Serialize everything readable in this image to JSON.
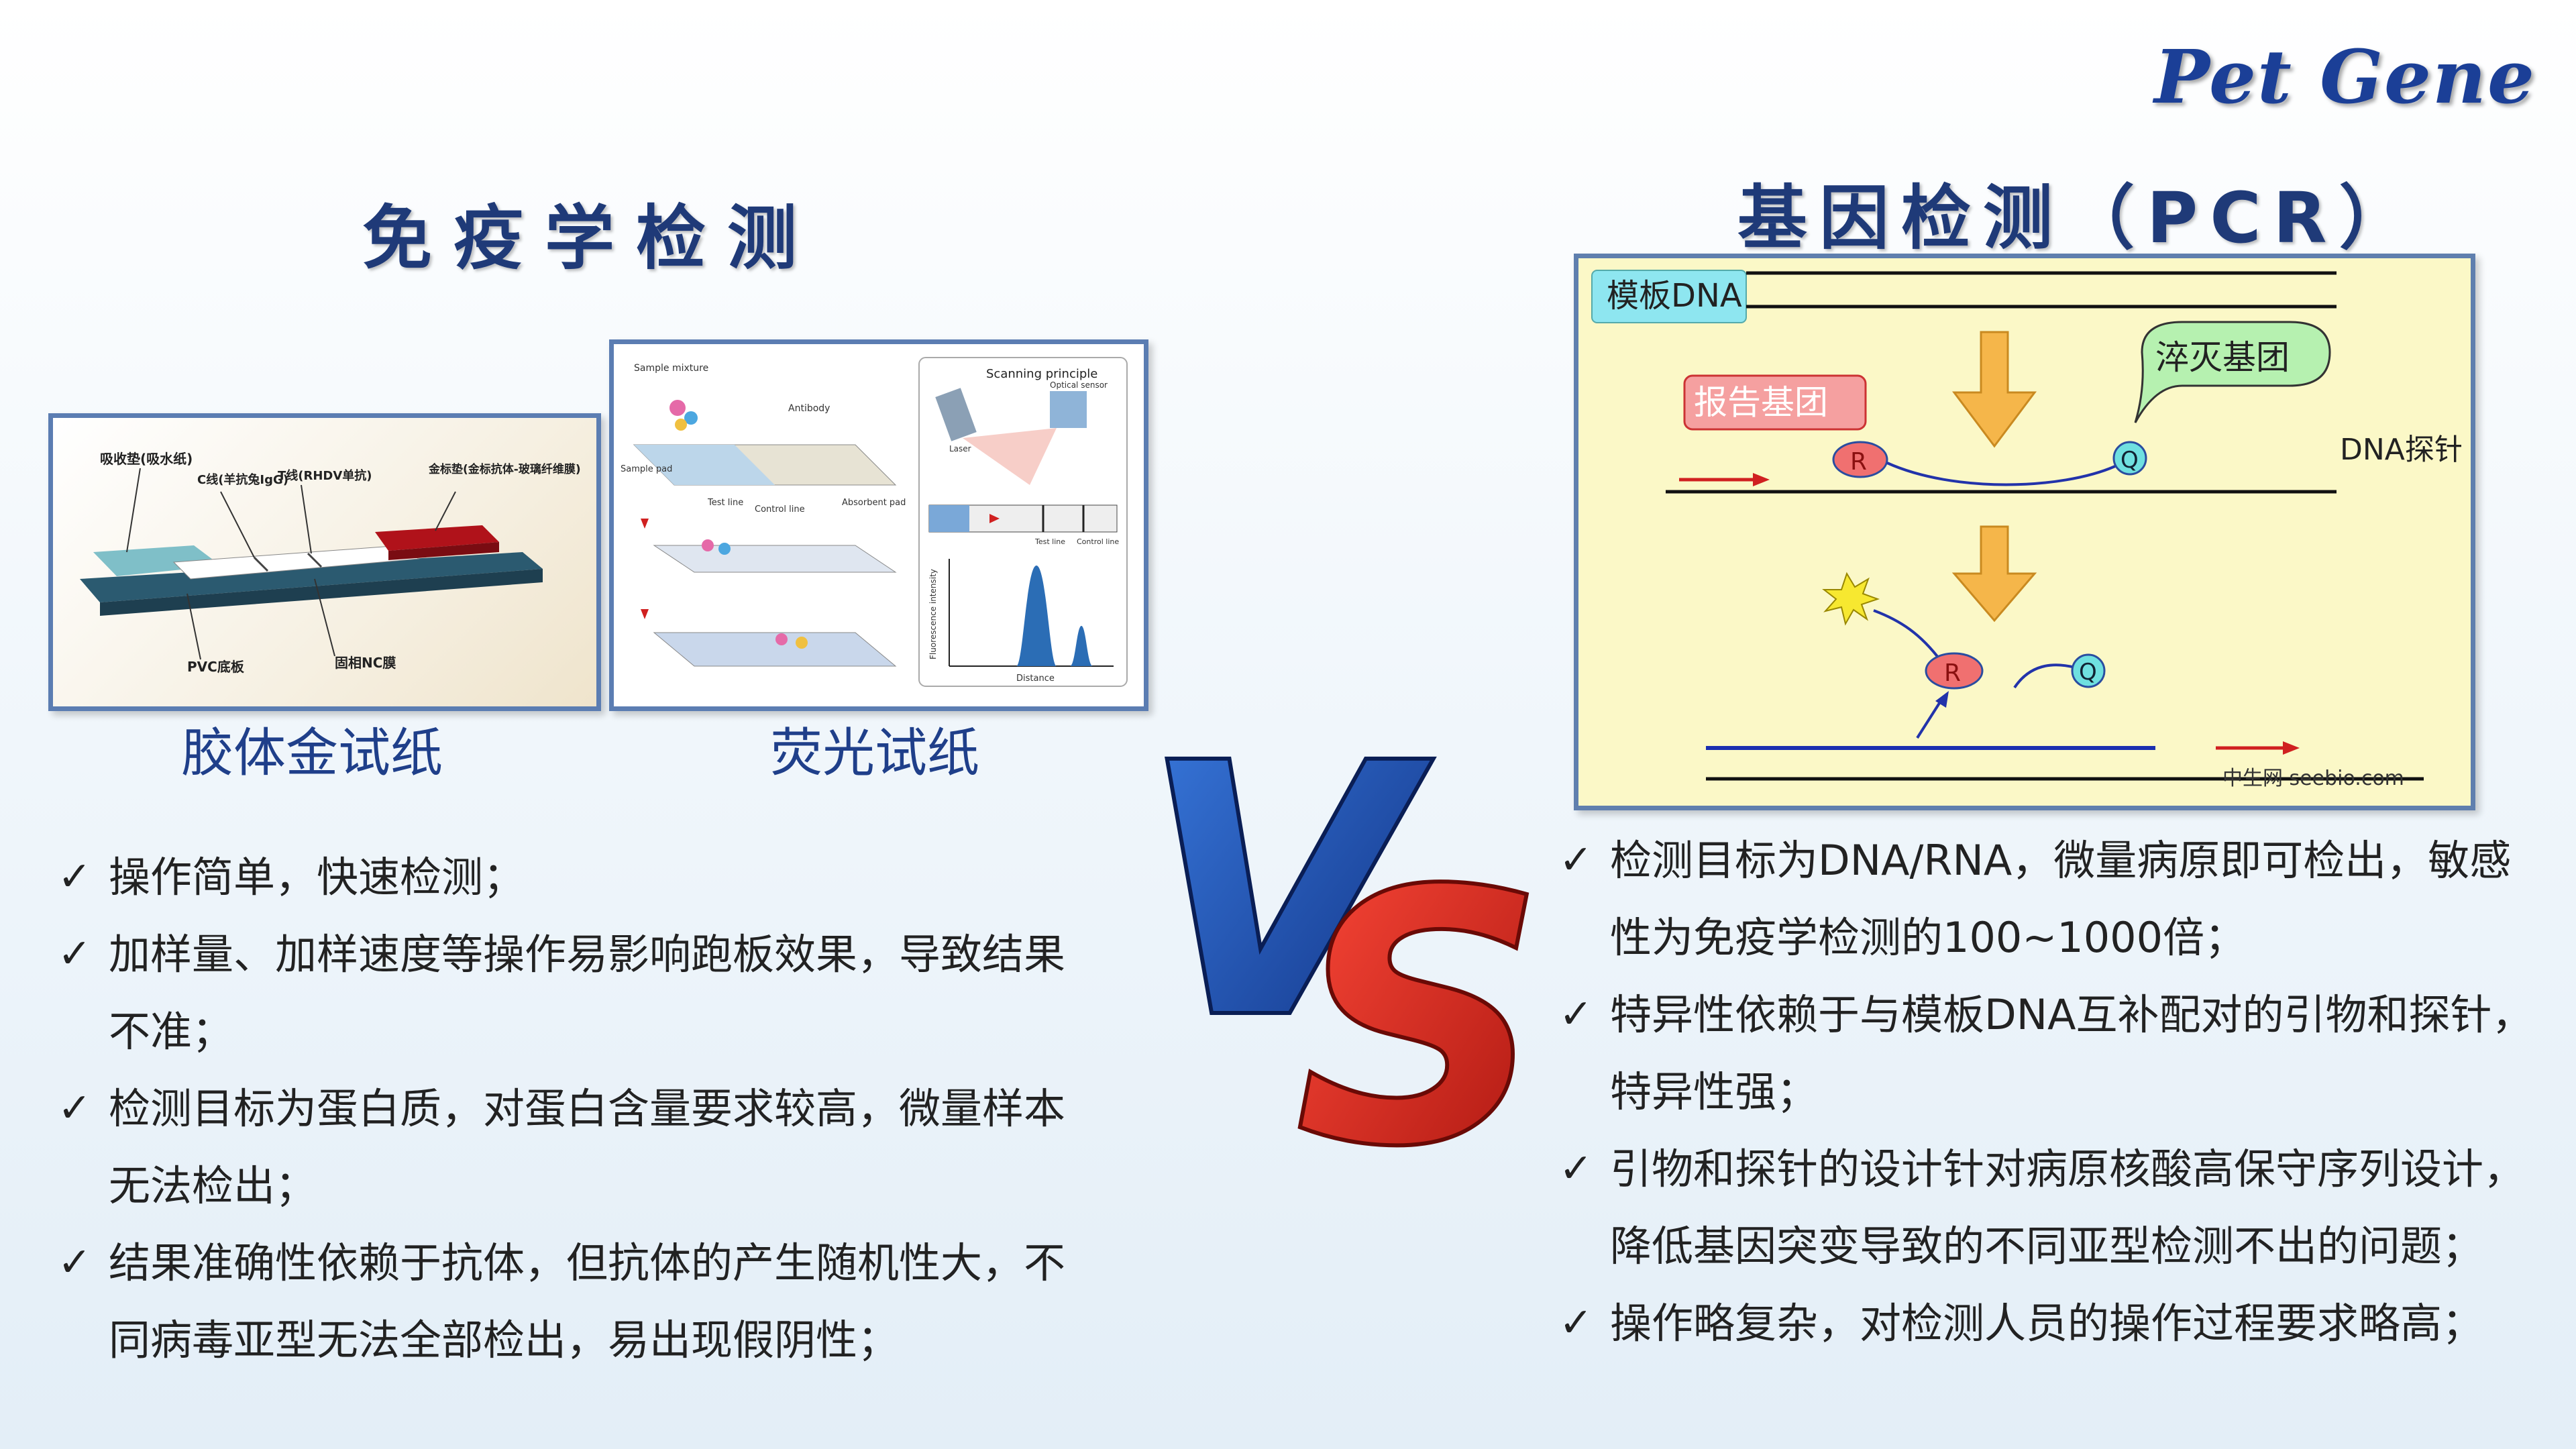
{
  "logo": "Pet Gene",
  "left": {
    "title": "免疫学检测",
    "caption_gold": "胶体金试纸",
    "caption_fluor": "荧光试纸",
    "gold_strip_labels": {
      "absorbent": "吸收垫(吸水纸)",
      "c_line": "C线(羊抗兔IgG)",
      "t_line": "T线(RHDV单抗)",
      "gold_pad": "金标垫(金标抗体-玻璃纤维膜)",
      "pvc": "PVC底板",
      "nc": "固相NC膜"
    },
    "fluor_labels": {
      "sample_mixture": "Sample mixture",
      "antibody": "Antibody",
      "sample_pad": "Sample pad",
      "test_line": "Test line",
      "control_line": "Control line",
      "absorbent_pad": "Absorbent pad",
      "scanning": "Scanning principle",
      "laser": "Laser",
      "optical_sensor": "Optical sensor",
      "test_line2": "Test line",
      "control_line2": "Control line",
      "y_axis": "Fluorescence intensity",
      "x_axis": "Distance"
    },
    "bullets": [
      "操作简单，快速检测；",
      "加样量、加样速度等操作易影响跑板效果，导致结果不准；",
      "检测目标为蛋白质，对蛋白含量要求较高，微量样本无法检出；",
      "结果准确性依赖于抗体，但抗体的产生随机性大，不同病毒亚型无法全部检出，易出现假阴性；"
    ]
  },
  "right": {
    "title": "基因检测（PCR）",
    "diagram": {
      "template": "模板DNA",
      "reporter": "报告基团",
      "quencher": "淬灭基团",
      "probe": "DNA探针",
      "r": "R",
      "q": "Q",
      "watermark": "中生网 seebio.com"
    },
    "bullets": [
      "检测目标为DNA/RNA，微量病原即可检出，敏感性为免疫学检测的100~1000倍；",
      "特异性依赖于与模板DNA互补配对的引物和探针，特异性强；",
      "引物和探针的设计针对病原核酸高保守序列设计，降低基因突变导致的不同亚型检测不出的问题；",
      "操作略复杂，对检测人员的操作过程要求略高；"
    ]
  },
  "check_glyph": "✓",
  "vs": {
    "v": "V",
    "s": "S"
  },
  "colors": {
    "title": "#1f3a78",
    "caption": "#1f3f8a",
    "frame": "#5b7db2",
    "v_blue": "#1d4fa8",
    "s_red": "#d6342a"
  }
}
